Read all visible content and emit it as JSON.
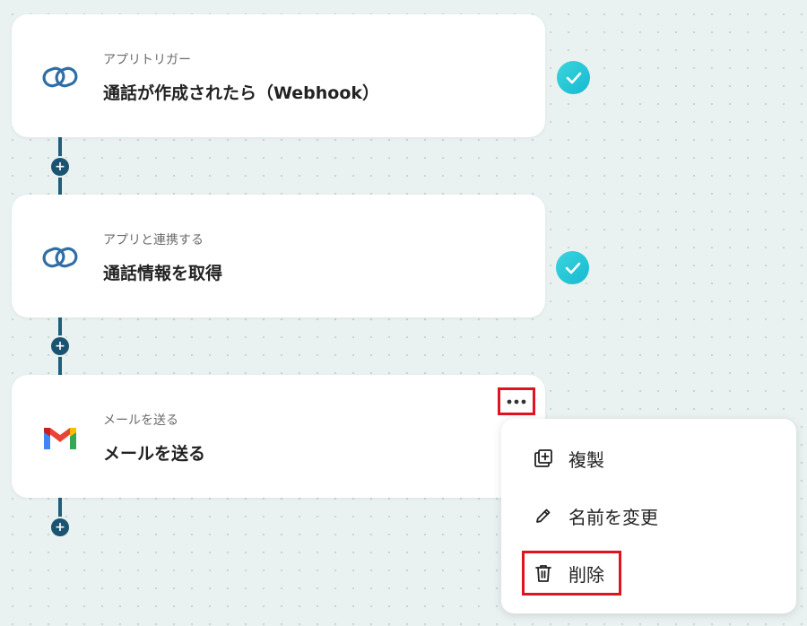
{
  "flow": {
    "steps": [
      {
        "subtitle": "アプリトリガー",
        "title": "通話が作成されたら（Webhook）",
        "icon": "link-chain-icon",
        "status": "completed"
      },
      {
        "subtitle": "アプリと連携する",
        "title": "通話情報を取得",
        "icon": "link-chain-icon",
        "status": "completed"
      },
      {
        "subtitle": "メールを送る",
        "title": "メールを送る",
        "icon": "gmail-icon",
        "status": "none"
      }
    ],
    "add_step_symbol": "+"
  },
  "context_menu": {
    "items": [
      {
        "label": "複製",
        "icon": "duplicate-icon"
      },
      {
        "label": "名前を変更",
        "icon": "pencil-icon"
      },
      {
        "label": "削除",
        "icon": "trash-icon"
      }
    ]
  },
  "colors": {
    "connector": "#1f5f7a",
    "check_badge": "#22c5d8",
    "highlight": "#e0141f",
    "link_icon": "#2f6ea6"
  }
}
